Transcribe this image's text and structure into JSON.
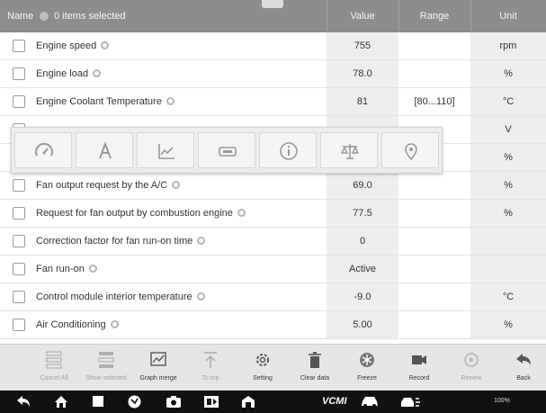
{
  "header": {
    "name_label": "Name",
    "selection_status": "0 items selected",
    "value_label": "Value",
    "range_label": "Range",
    "unit_label": "Unit"
  },
  "rows": [
    {
      "name": "Engine speed",
      "value": "755",
      "range": "",
      "unit": "rpm"
    },
    {
      "name": "Engine load",
      "value": "78.0",
      "range": "",
      "unit": "%"
    },
    {
      "name": "Engine Coolant Temperature",
      "value": "81",
      "range": "[80...110]",
      "unit": "°C"
    },
    {
      "name": "",
      "value": "",
      "range": "",
      "unit": "V"
    },
    {
      "name": "",
      "value": "",
      "range": "",
      "unit": "%"
    },
    {
      "name": "Fan output request by the A/C",
      "value": "69.0",
      "range": "",
      "unit": "%"
    },
    {
      "name": "Request for fan output by combustion engine",
      "value": "77.5",
      "range": "",
      "unit": "%"
    },
    {
      "name": "Correction factor for fan run-on time",
      "value": "0",
      "range": "",
      "unit": ""
    },
    {
      "name": "Fan run-on",
      "value": "Active",
      "range": "",
      "unit": ""
    },
    {
      "name": "Control module interior temperature",
      "value": "-9.0",
      "range": "",
      "unit": "°C"
    },
    {
      "name": "Air Conditioning",
      "value": "5.00",
      "range": "",
      "unit": "%"
    }
  ],
  "display_modes": [
    "gauge-icon",
    "text-icon",
    "line-graph-icon",
    "digital-icon",
    "info-icon",
    "scale-icon",
    "location-pin-icon"
  ],
  "toolbar": {
    "cancel_all": "Cancel All",
    "show_selected": "Show selected",
    "graph_merge": "Graph merge",
    "to_top": "To top",
    "setting": "Setting",
    "clear_data": "Clear data",
    "freeze": "Freeze",
    "record": "Record",
    "review": "Review",
    "back": "Back"
  },
  "navbar": {
    "vcmi_label": "VCMI",
    "status_text": "100%"
  }
}
